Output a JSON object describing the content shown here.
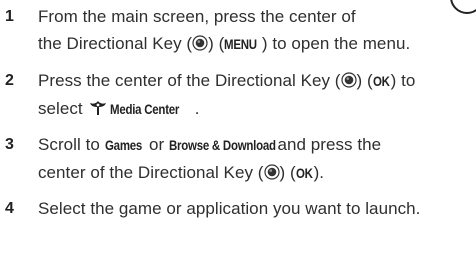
{
  "steps": [
    {
      "number": "1",
      "line1": "From the main screen, press the center of",
      "line2_pre": "the Directional Key (",
      "line2_mid": ") (",
      "line2_kw": "MENU",
      "line2_post": ") to open the menu."
    },
    {
      "number": "2",
      "line1_pre": "Press the center of the Directional Key (",
      "line1_mid": ") (",
      "line1_kw": "OK",
      "line1_post": ") to",
      "line2_pre": "select ",
      "line2_kw": "Media Center",
      "line2_post": "."
    },
    {
      "number": "3",
      "line1_pre": "Scroll to ",
      "kw_games": "Games",
      "or": " or ",
      "kw_browse": "Browse & Download",
      "line1_post": " and press the",
      "line2_pre": "center of the Directional Key (",
      "line2_mid": ") (",
      "line2_kw": "OK",
      "line2_post": ")."
    },
    {
      "number": "4",
      "line1": "Select the game or application you want to launch."
    }
  ],
  "icons": {
    "directional_key": "directional-key-icon",
    "media_center": "media-center-icon"
  }
}
